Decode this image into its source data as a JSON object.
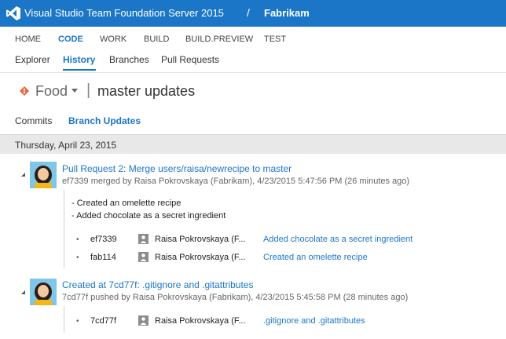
{
  "header": {
    "product": "Visual Studio Team Foundation Server 2015",
    "separator": "/",
    "project": "Fabrikam"
  },
  "main_nav": [
    "HOME",
    "CODE",
    "WORK",
    "BUILD",
    "BUILD.PREVIEW",
    "TEST"
  ],
  "main_nav_active": "CODE",
  "sub_nav": [
    "Explorer",
    "History",
    "Branches",
    "Pull Requests"
  ],
  "sub_nav_active": "History",
  "repo": {
    "name": "Food",
    "separator": "|",
    "title": "master updates"
  },
  "pivots": [
    "Commits",
    "Branch Updates"
  ],
  "pivot_active": "Branch Updates",
  "date_header": "Thursday, April 23, 2015",
  "events": [
    {
      "title": "Pull Request 2: Merge users/raisa/newrecipe to master",
      "subtitle": "ef7339 merged by Raisa Pokrovskaya (Fabrikam), 4/23/2015 5:47:56 PM (26 minutes ago)",
      "messages": [
        "- Created an omelette recipe",
        "- Added chocolate as a secret ingredient"
      ],
      "commits": [
        {
          "id": "ef7339",
          "author": "Raisa Pokrovskaya (F...",
          "message": "Added chocolate as a secret ingredient"
        },
        {
          "id": "fab114",
          "author": "Raisa Pokrovskaya (F...",
          "message": "Created an omelette recipe"
        }
      ]
    },
    {
      "title": "Created at 7cd77f: .gitignore and .gitattributes",
      "subtitle": "7cd77f pushed by Raisa Pokrovskaya (Fabrikam), 4/23/2015 5:45:58 PM (28 minutes ago)",
      "commits": [
        {
          "id": "7cd77f",
          "author": "Raisa Pokrovskaya (F...",
          "message": ".gitignore and .gitattributes"
        }
      ]
    }
  ],
  "bullet": "•",
  "colors": {
    "accent": "#1c76c8",
    "date_band": "#e8e8e8",
    "repo_icon": "#e8643c"
  },
  "icons": [
    "visual-studio-logo",
    "git-repo-icon",
    "dropdown-caret",
    "collapse-arrow",
    "user-avatar",
    "user-icon"
  ]
}
